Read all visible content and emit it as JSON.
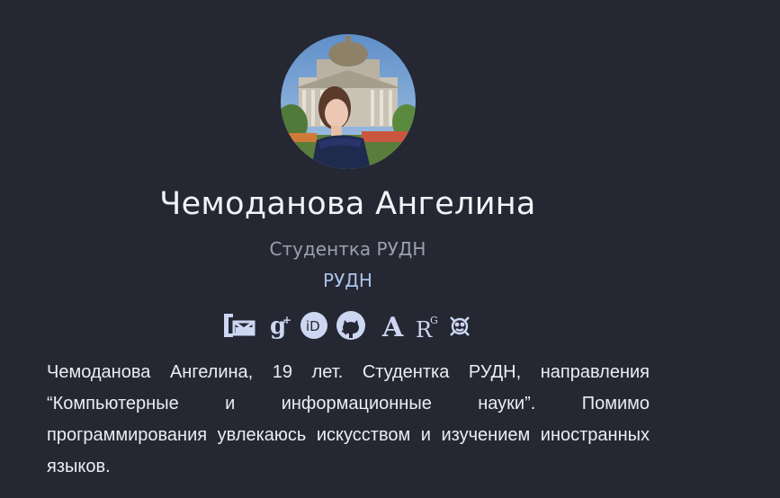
{
  "profile": {
    "name": "Чемоданова Ангелина",
    "role": "Студентка РУДН",
    "organization": "РУДН",
    "bio": "Чемоданова Ангелина, 19 лет. Студентка РУДН, направления “Компьютерные и информационные науки”. Помимо программирования увлекаюсь искусством и изучением иностранных языков."
  },
  "social_icons": [
    {
      "name": "email-icon"
    },
    {
      "name": "google-scholar-icon"
    },
    {
      "name": "orcid-icon"
    },
    {
      "name": "github-icon"
    },
    {
      "name": "academia-icon"
    },
    {
      "name": "researchgate-icon"
    },
    {
      "name": "keybase-icon"
    }
  ],
  "colors": {
    "background": "#252833",
    "name": "#f1f3f7",
    "role": "#9aa0ab",
    "organization": "#aac2ea",
    "icons": "#cdd7f2"
  }
}
